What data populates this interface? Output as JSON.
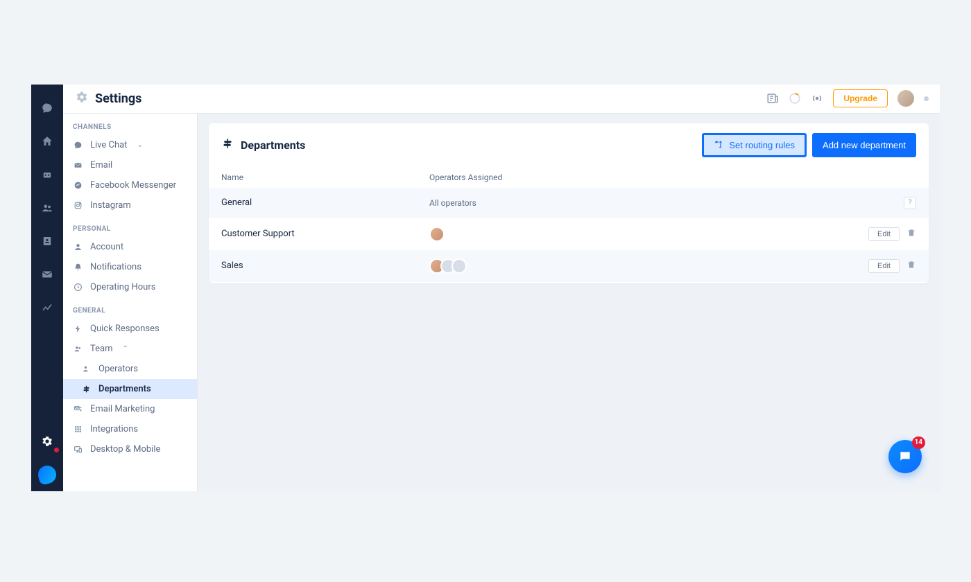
{
  "topbar": {
    "title": "Settings",
    "upgrade_label": "Upgrade"
  },
  "sidebar": {
    "sections": {
      "channels": {
        "title": "CHANNELS",
        "items": [
          {
            "label": "Live Chat",
            "expandable": true
          },
          {
            "label": "Email"
          },
          {
            "label": "Facebook Messenger"
          },
          {
            "label": "Instagram"
          }
        ]
      },
      "personal": {
        "title": "PERSONAL",
        "items": [
          {
            "label": "Account"
          },
          {
            "label": "Notifications"
          },
          {
            "label": "Operating Hours"
          }
        ]
      },
      "general": {
        "title": "GENERAL",
        "items": [
          {
            "label": "Quick Responses"
          },
          {
            "label": "Team",
            "expandable": true,
            "expanded": true
          },
          {
            "label": "Operators",
            "sub": true
          },
          {
            "label": "Departments",
            "sub": true,
            "active": true
          },
          {
            "label": "Email Marketing"
          },
          {
            "label": "Integrations"
          },
          {
            "label": "Desktop & Mobile"
          }
        ]
      }
    }
  },
  "panel": {
    "title": "Departments",
    "routing_label": "Set routing rules",
    "add_label": "Add new department",
    "columns": {
      "name": "Name",
      "operators": "Operators Assigned"
    },
    "rows": [
      {
        "name": "General",
        "operators_text": "All operators",
        "avatars": 0,
        "help": "?"
      },
      {
        "name": "Customer Support",
        "operators_text": "",
        "avatars": 1,
        "edit_label": "Edit"
      },
      {
        "name": "Sales",
        "operators_text": "",
        "avatars": 3,
        "edit_label": "Edit"
      }
    ]
  },
  "fab": {
    "badge": "14"
  }
}
